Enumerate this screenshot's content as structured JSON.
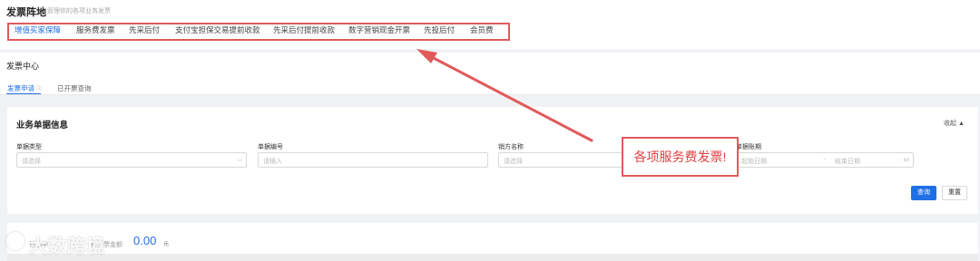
{
  "header": {
    "title": "发票阵地",
    "subtitle": "管理你的各项业务发票"
  },
  "tabs": [
    {
      "label": "增值买家保障",
      "active": true
    },
    {
      "label": "服务费发票",
      "active": false
    },
    {
      "label": "先采后付",
      "active": false
    },
    {
      "label": "支付宝担保交易提前收款",
      "active": false
    },
    {
      "label": "先采后付提前收款",
      "active": false
    },
    {
      "label": "数字营销现金开票",
      "active": false
    },
    {
      "label": "先投后付",
      "active": false
    },
    {
      "label": "会员费",
      "active": false
    }
  ],
  "section": {
    "title": "发票中心",
    "subtabs": [
      {
        "label": "发票申请",
        "active": true
      },
      {
        "label": "已开票查询",
        "active": false
      }
    ]
  },
  "panel": {
    "title": "业务单据信息",
    "collapse_label": "收起 ▲",
    "fields": {
      "doc_type": {
        "label": "单据类型",
        "placeholder": "请选择"
      },
      "doc_no": {
        "label": "单据编号",
        "placeholder": "请输入"
      },
      "seller": {
        "label": "销方名称",
        "placeholder": "请选择"
      },
      "period": {
        "label": "单据账期",
        "start_placeholder": "起始日期",
        "separator": "-",
        "end_placeholder": "结束日期"
      }
    },
    "query_button": "查询",
    "reset_button": "重置"
  },
  "callout": {
    "text": "各项服务费发票!"
  },
  "summary": {
    "amount": "0.00",
    "unit": "元",
    "faint_left": "已选中",
    "faint_right": "可开票金额"
  },
  "watermark": "大数跨境",
  "colors": {
    "accent": "#1f6fe5",
    "annotation": "#e05a5a"
  }
}
